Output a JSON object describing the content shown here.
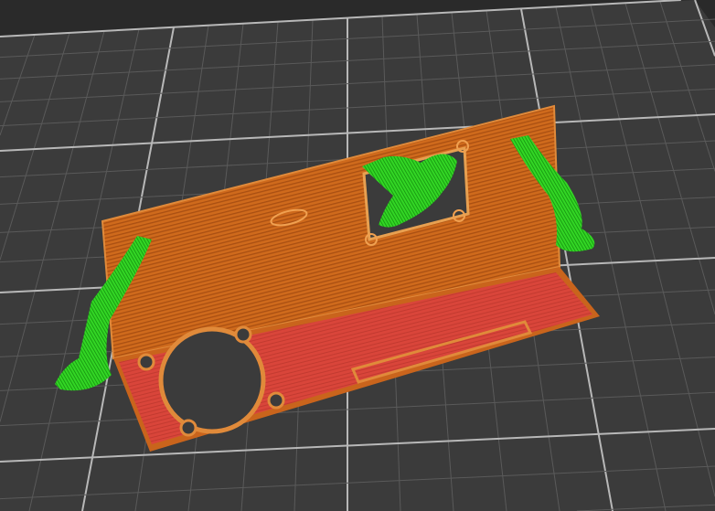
{
  "viewport": {
    "view": "3d-slice-preview",
    "colors": {
      "background": "#2a2a2a",
      "bed": "#3a3a3a",
      "grid_minor": "#5a5a5a",
      "grid_major": "#b8b8b8",
      "perimeter": "#d2701f",
      "perimeter_dark": "#a84f12",
      "infill": "#d9453a",
      "support": "#2ed320",
      "support_dark": "#179a10"
    }
  }
}
